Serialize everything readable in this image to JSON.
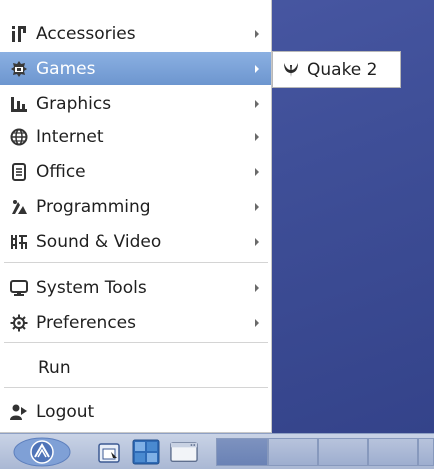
{
  "menu": {
    "items": [
      {
        "label": "Accessories",
        "icon": "accessories-icon",
        "has_submenu": true
      },
      {
        "label": "Games",
        "icon": "games-icon",
        "has_submenu": true,
        "active": true
      },
      {
        "label": "Graphics",
        "icon": "graphics-icon",
        "has_submenu": true
      },
      {
        "label": "Internet",
        "icon": "internet-globe-icon",
        "has_submenu": true
      },
      {
        "label": "Office",
        "icon": "office-document-icon",
        "has_submenu": true
      },
      {
        "label": "Programming",
        "icon": "programming-icon",
        "has_submenu": true
      },
      {
        "label": "Sound & Video",
        "icon": "sound-video-icon",
        "has_submenu": true
      },
      {
        "label": "System Tools",
        "icon": "monitor-icon",
        "has_submenu": true
      },
      {
        "label": "Preferences",
        "icon": "gear-icon",
        "has_submenu": true
      },
      {
        "label": "Run",
        "icon": "",
        "has_submenu": false
      },
      {
        "label": "Logout",
        "icon": "logout-icon",
        "has_submenu": false
      }
    ]
  },
  "submenu": {
    "items": [
      {
        "label": "Quake 2",
        "icon": "quake-icon"
      }
    ]
  },
  "taskbar": {
    "start_icon": "start-menu-icon",
    "launchers": [
      "file-manager-icon",
      "desktop-switch-icon",
      "terminal-window-icon"
    ]
  },
  "colors": {
    "menu_highlight": "#7aa3d9",
    "desktop": "#3f4f98",
    "taskbar": "#b8c5de"
  }
}
